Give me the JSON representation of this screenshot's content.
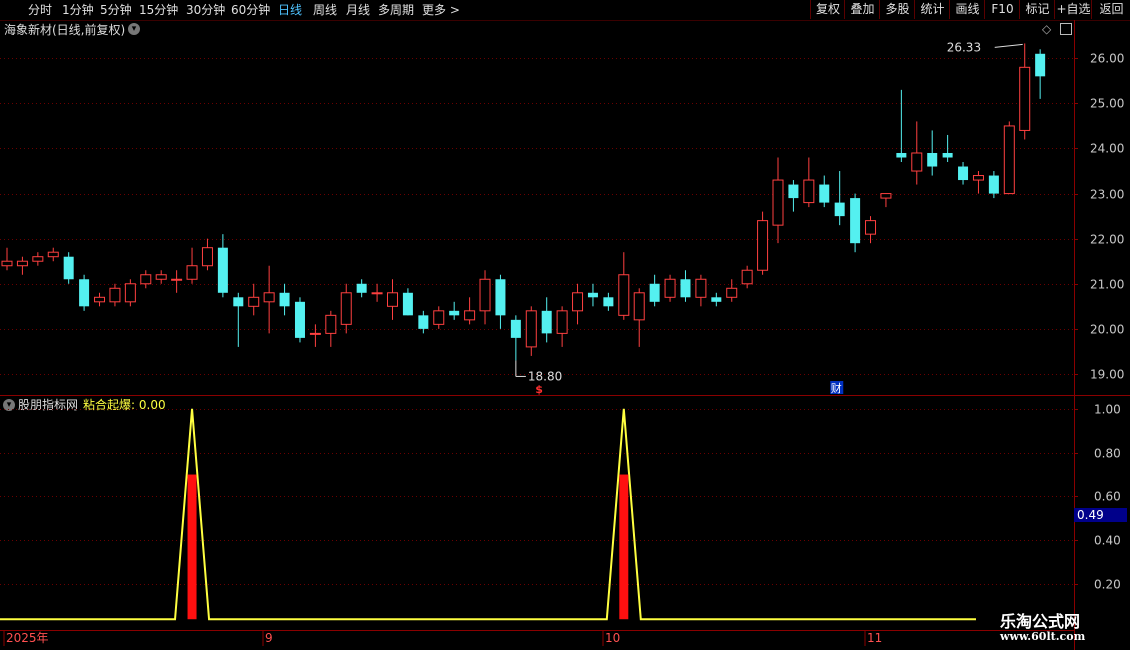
{
  "toolbar": {
    "periods": [
      "分时",
      "1分钟",
      "5分钟",
      "15分钟",
      "30分钟",
      "60分钟",
      "日线",
      "周线",
      "月线",
      "多周期",
      "更多 >"
    ],
    "active": "日线",
    "right_buttons": [
      "复权",
      "叠加",
      "多股",
      "统计",
      "画线",
      "F10",
      "标记",
      "+自选",
      "返回"
    ]
  },
  "main_panel": {
    "title": "海象新材(日线,前复权)",
    "high_label": "26.33",
    "low_label": "18.80",
    "event_marks": [
      "$",
      "财"
    ],
    "colors": {
      "up": "#ff4040",
      "down": "#54f0f0",
      "grid": "#6a0000",
      "axis_text": "#c8c8c8"
    }
  },
  "indicator_panel": {
    "name": "股朋指标网",
    "series_label": "粘合起爆",
    "series_value": "0.00",
    "current_value_tag": "0.49",
    "colors": {
      "line": "#ffff40",
      "bar": "#ff1010"
    }
  },
  "x_axis": {
    "labels": [
      "2025年",
      "9",
      "10",
      "11"
    ]
  },
  "watermark": {
    "name": "乐淘公式网",
    "url": "www.60lt.com"
  },
  "chart_data": [
    {
      "type": "candlestick",
      "y_ticks": [
        19,
        20,
        21,
        22,
        23,
        24,
        25,
        26
      ],
      "ylim": [
        18.6,
        26.45
      ],
      "candles": [
        [
          21.4,
          21.5,
          21.8,
          21.3
        ],
        [
          21.4,
          21.5,
          21.6,
          21.2
        ],
        [
          21.5,
          21.6,
          21.7,
          21.4
        ],
        [
          21.6,
          21.7,
          21.8,
          21.5
        ],
        [
          21.6,
          21.1,
          21.7,
          21.0
        ],
        [
          21.1,
          20.5,
          21.2,
          20.4
        ],
        [
          20.6,
          20.7,
          20.8,
          20.5
        ],
        [
          20.6,
          20.9,
          21.0,
          20.5
        ],
        [
          20.6,
          21.0,
          21.1,
          20.5
        ],
        [
          21.0,
          21.2,
          21.3,
          20.9
        ],
        [
          21.1,
          21.2,
          21.3,
          21.0
        ],
        [
          21.1,
          21.1,
          21.3,
          20.8
        ],
        [
          21.1,
          21.4,
          21.8,
          21.0
        ],
        [
          21.4,
          21.8,
          22.0,
          21.3
        ],
        [
          21.8,
          20.8,
          22.1,
          20.7
        ],
        [
          20.7,
          20.5,
          20.8,
          19.6
        ],
        [
          20.5,
          20.7,
          21.0,
          20.3
        ],
        [
          20.6,
          20.8,
          21.4,
          19.9
        ],
        [
          20.8,
          20.5,
          21.0,
          20.3
        ],
        [
          20.6,
          19.8,
          20.7,
          19.7
        ],
        [
          19.9,
          19.9,
          20.1,
          19.6
        ],
        [
          19.9,
          20.3,
          20.4,
          19.6
        ],
        [
          20.1,
          20.8,
          21.0,
          19.9
        ],
        [
          21.0,
          20.8,
          21.1,
          20.7
        ],
        [
          20.8,
          20.8,
          21.0,
          20.6
        ],
        [
          20.5,
          20.8,
          21.1,
          20.2
        ],
        [
          20.8,
          20.3,
          20.9,
          20.3
        ],
        [
          20.3,
          20.0,
          20.4,
          19.9
        ],
        [
          20.1,
          20.4,
          20.5,
          20.0
        ],
        [
          20.4,
          20.3,
          20.6,
          20.2
        ],
        [
          20.2,
          20.4,
          20.7,
          20.1
        ],
        [
          20.4,
          21.1,
          21.3,
          20.1
        ],
        [
          21.1,
          20.3,
          21.2,
          20.0
        ],
        [
          20.2,
          19.8,
          20.3,
          19.3
        ],
        [
          19.6,
          20.4,
          20.5,
          19.4
        ],
        [
          20.4,
          19.9,
          20.7,
          19.7
        ],
        [
          19.9,
          20.4,
          20.5,
          19.6
        ],
        [
          20.4,
          20.8,
          21.0,
          20.1
        ],
        [
          20.8,
          20.7,
          21.0,
          20.5
        ],
        [
          20.7,
          20.5,
          20.8,
          20.4
        ],
        [
          20.3,
          21.2,
          21.7,
          20.2
        ],
        [
          20.2,
          20.8,
          20.9,
          19.6
        ],
        [
          21.0,
          20.6,
          21.2,
          20.5
        ],
        [
          20.7,
          21.1,
          21.2,
          20.6
        ],
        [
          21.1,
          20.7,
          21.3,
          20.6
        ],
        [
          20.7,
          21.1,
          21.2,
          20.5
        ],
        [
          20.7,
          20.6,
          20.8,
          20.5
        ],
        [
          20.7,
          20.9,
          21.1,
          20.6
        ],
        [
          21.0,
          21.3,
          21.4,
          20.9
        ],
        [
          21.3,
          22.4,
          22.6,
          21.2
        ],
        [
          22.3,
          23.3,
          23.8,
          21.9
        ],
        [
          23.2,
          22.9,
          23.3,
          22.6
        ],
        [
          22.8,
          23.3,
          23.8,
          22.7
        ],
        [
          23.2,
          22.8,
          23.4,
          22.7
        ],
        [
          22.8,
          22.5,
          23.5,
          22.3
        ],
        [
          22.9,
          21.9,
          23.0,
          21.7
        ],
        [
          22.1,
          22.4,
          22.5,
          21.9
        ],
        [
          22.9,
          23.0,
          23.0,
          22.7
        ],
        [
          23.9,
          23.8,
          25.3,
          23.7
        ],
        [
          23.5,
          23.9,
          24.6,
          23.2
        ],
        [
          23.9,
          23.6,
          24.4,
          23.4
        ],
        [
          23.9,
          23.8,
          24.3,
          23.7
        ],
        [
          23.6,
          23.3,
          23.7,
          23.2
        ],
        [
          23.3,
          23.4,
          23.5,
          23.0
        ],
        [
          23.4,
          23.0,
          23.5,
          22.9
        ],
        [
          23.0,
          24.5,
          24.6,
          23.0
        ],
        [
          24.4,
          25.8,
          26.33,
          24.2
        ],
        [
          26.1,
          25.6,
          26.2,
          25.1
        ]
      ]
    },
    {
      "type": "line",
      "series_name": "粘合起爆",
      "y_ticks": [
        0.2,
        0.4,
        0.6,
        0.8,
        1.0
      ],
      "ylim": [
        0.0,
        1.04
      ],
      "spikes": [
        {
          "candle_index": 12,
          "line_value": 1.0,
          "bar_value": 0.7
        },
        {
          "candle_index": 40,
          "line_value": 1.0,
          "bar_value": 0.7
        }
      ]
    }
  ]
}
